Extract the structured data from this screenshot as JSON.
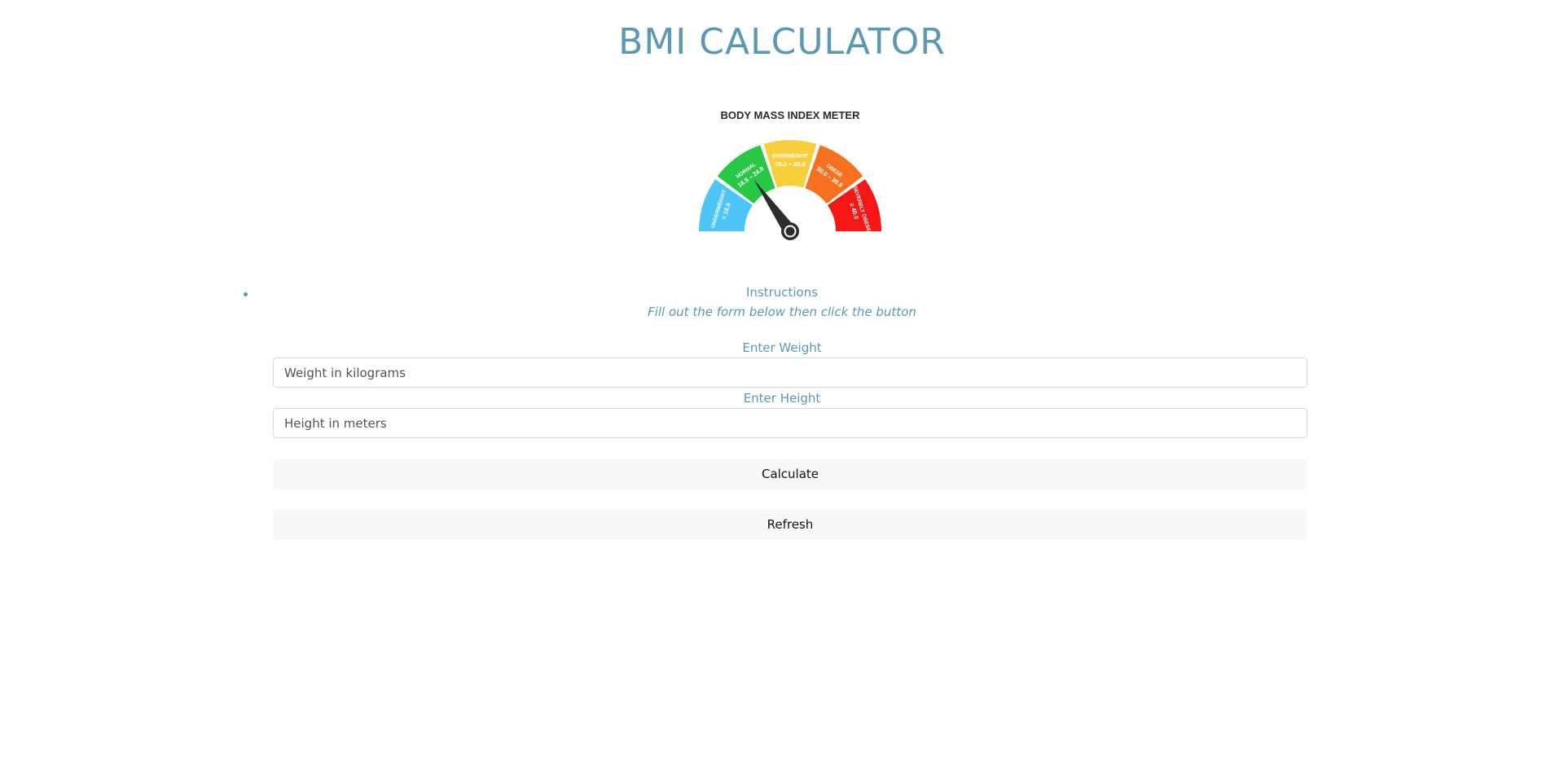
{
  "page": {
    "title": "BMI CALCULATOR"
  },
  "meter": {
    "title": "BODY MASS INDEX METER",
    "segments": [
      {
        "name": "UNDERWEIGHT",
        "range": "< 18.5",
        "color": "#4ec6f5"
      },
      {
        "name": "NORMAL",
        "range": "18.5 – 24.9",
        "color": "#29c746"
      },
      {
        "name": "OVERWEIGHT",
        "range": "25.0 – 29.9",
        "color": "#f7cf3d"
      },
      {
        "name": "OBESE",
        "range": "30.0 – 39.9",
        "color": "#f6711f"
      },
      {
        "name": "SEVERELY OBESE",
        "range": "≥ 40.0",
        "color": "#f51616"
      }
    ],
    "needle_color": "#2d2d2d"
  },
  "instructions": {
    "title": "Instructions",
    "text": "Fill out the form below then click the button"
  },
  "form": {
    "weight_label": "Enter Weight",
    "weight_placeholder": "Weight in kilograms",
    "weight_value": "",
    "height_label": "Enter Height",
    "height_placeholder": "Height in meters",
    "height_value": "",
    "calculate_label": "Calculate",
    "refresh_label": "Refresh"
  },
  "colors": {
    "accent": "#5b98b4"
  }
}
